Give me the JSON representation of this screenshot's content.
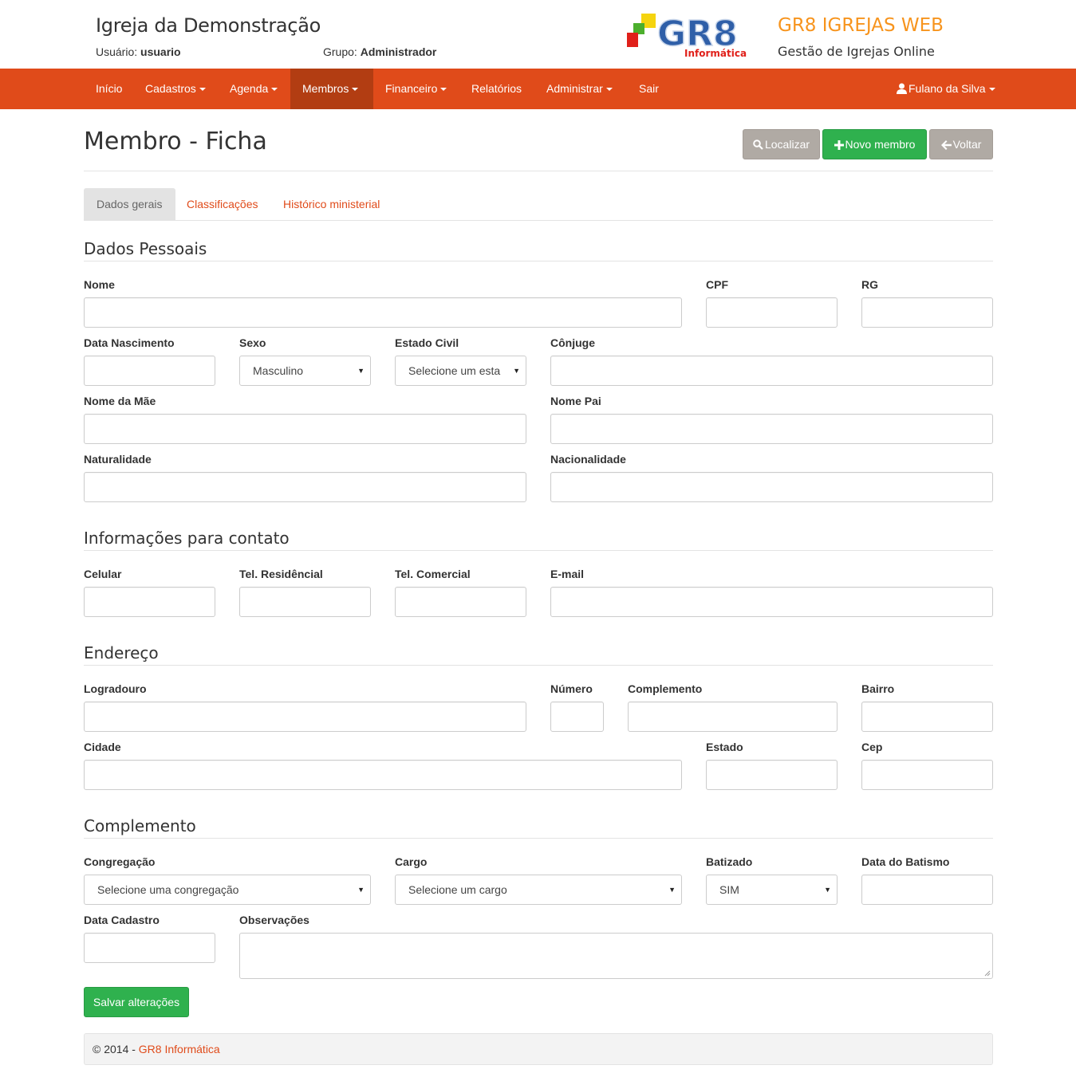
{
  "header": {
    "church_name": "Igreja da Demonstração",
    "user_label": "Usuário:",
    "user_value": "usuario",
    "group_label": "Grupo:",
    "group_value": "Administrador",
    "logo_text": "GR8",
    "logo_subtext": "Informática",
    "brand_title": "GR8 IGREJAS WEB",
    "brand_subtitle": "Gestão de Igrejas Online"
  },
  "nav": {
    "items": [
      {
        "label": "Início"
      },
      {
        "label": "Cadastros"
      },
      {
        "label": "Agenda"
      },
      {
        "label": "Membros"
      },
      {
        "label": "Financeiro"
      },
      {
        "label": "Relatórios"
      },
      {
        "label": "Administrar"
      },
      {
        "label": "Sair"
      }
    ],
    "user_menu": "Fulano da Silva"
  },
  "page": {
    "title": "Membro - Ficha",
    "buttons": {
      "search": "Localizar",
      "new_member": "Novo membro",
      "back": "Voltar"
    }
  },
  "tabs": [
    {
      "label": "Dados gerais"
    },
    {
      "label": "Classificações"
    },
    {
      "label": "Histórico ministerial"
    }
  ],
  "sections": {
    "personal": "Dados Pessoais",
    "contact": "Informações para contato",
    "address": "Endereço",
    "complement": "Complemento"
  },
  "fields": {
    "nome": "Nome",
    "cpf": "CPF",
    "rg": "RG",
    "data_nascimento": "Data Nascimento",
    "sexo": "Sexo",
    "sexo_value": "Masculino",
    "estado_civil": "Estado Civil",
    "estado_civil_value": "Selecione um esta",
    "conjuge": "Cônjuge",
    "nome_mae": "Nome da Mãe",
    "nome_pai": "Nome Pai",
    "naturalidade": "Naturalidade",
    "nacionalidade": "Nacionalidade",
    "celular": "Celular",
    "tel_residencial": "Tel. Residêncial",
    "tel_comercial": "Tel. Comercial",
    "email": "E-mail",
    "logradouro": "Logradouro",
    "numero": "Número",
    "complemento": "Complemento",
    "bairro": "Bairro",
    "cidade": "Cidade",
    "estado": "Estado",
    "cep": "Cep",
    "congregacao": "Congregação",
    "congregacao_value": "Selecione uma congregação",
    "cargo": "Cargo",
    "cargo_value": "Selecione um cargo",
    "batizado": "Batizado",
    "batizado_value": "SIM",
    "data_batismo": "Data do Batismo",
    "data_cadastro": "Data Cadastro",
    "observacoes": "Observações"
  },
  "save_button": "Salvar alterações",
  "footer": {
    "copyright": "© 2014 - ",
    "link": "GR8 Informática"
  },
  "colors": {
    "brand_orange": "#e04b1a",
    "nav_active": "#b23d12",
    "brand_title": "#f7941d",
    "green": "#2fb14e",
    "gray_button": "#b0aaa4"
  }
}
